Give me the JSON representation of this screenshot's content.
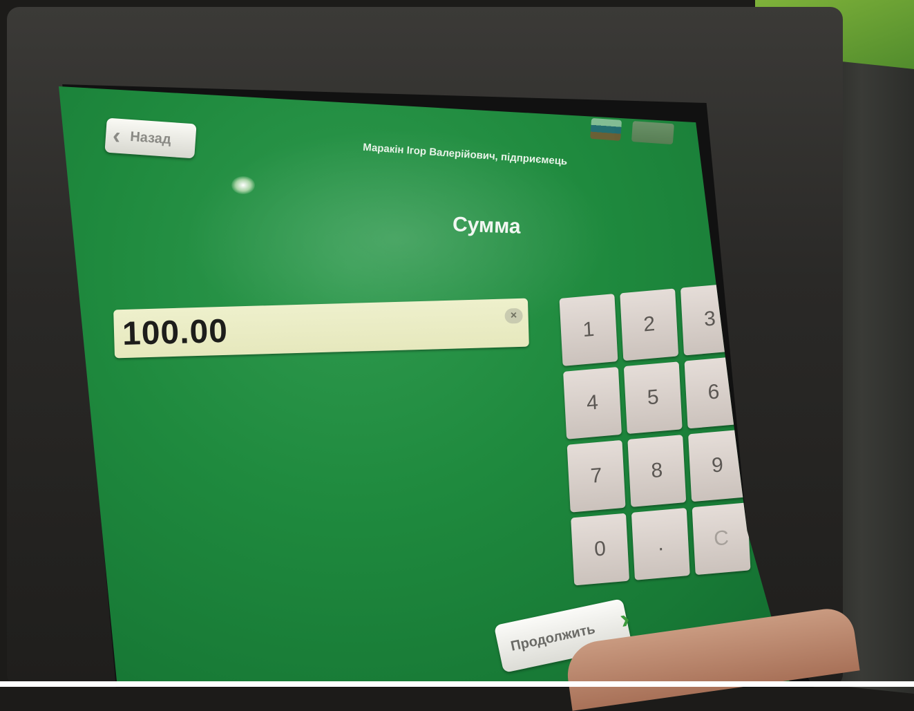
{
  "header": {
    "back_label": "Назад",
    "merchant": "Маракін Ігор Валерійович, підприємець"
  },
  "main": {
    "title": "Сумма",
    "amount_value": "100.00",
    "clear_symbol": "×"
  },
  "keypad": {
    "keys": [
      "1",
      "2",
      "3",
      "4",
      "5",
      "6",
      "7",
      "8",
      "9",
      "0",
      ".",
      "C"
    ]
  },
  "footer": {
    "continue_label": "Продолжить"
  },
  "colors": {
    "screen_green": "#1f8a3e",
    "field_bg": "#eef0cc",
    "key_bg": "#e5ddd8",
    "continue_chevron": "#3c9a3c"
  }
}
